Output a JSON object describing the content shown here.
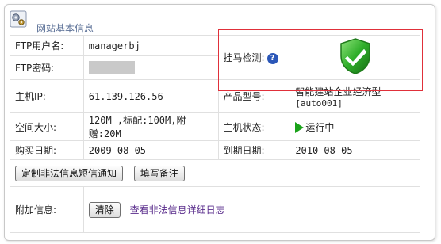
{
  "header": {
    "title": "网站基本信息"
  },
  "rows": {
    "ftp_user": {
      "label": "FTP用户名:",
      "value": "managerbj"
    },
    "ftp_password": {
      "label": "FTP密码:"
    },
    "trojan_check": {
      "label": "挂马检测:",
      "help": "?",
      "status_icon": "green-check-shield-icon"
    },
    "host_ip": {
      "label": "主机IP:",
      "value": "61.139.126.56"
    },
    "product_model": {
      "label": "产品型号:",
      "value": "智能建站企业经济型",
      "code": "[auto001]"
    },
    "space_size": {
      "label": "空间大小:",
      "value": "120M ,标配:100M,附赠:20M"
    },
    "host_status": {
      "label": "主机状态:",
      "value": "运行中",
      "icon": "play-icon"
    },
    "purchase_date": {
      "label": "购买日期:",
      "value": "2009-08-05"
    },
    "expire_date": {
      "label": "到期日期:",
      "value": "2010-08-05"
    }
  },
  "actions": {
    "sms_notify_button": "定制非法信息短信通知",
    "note_button": "填写备注"
  },
  "extra": {
    "label": "附加信息:",
    "clear_button": "清除",
    "log_link": "查看非法信息详细日志"
  },
  "colors": {
    "accent": "#5a6f96",
    "highlight_border": "#e0303a",
    "status_green": "#1aa21a",
    "link": "#5a2d8c"
  }
}
